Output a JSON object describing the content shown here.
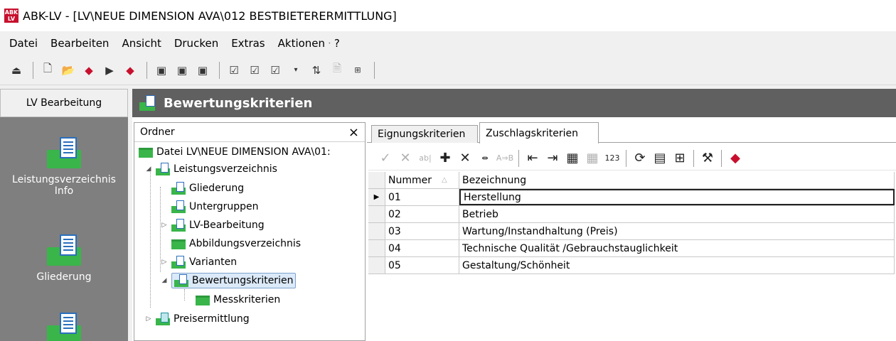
{
  "window": {
    "title": "ABK-LV - [LV\\NEUE DIMENSION AVA\\012 BESTBIETERERMITTLUNG]",
    "app_icon_text_top": "ABK",
    "app_icon_text_bottom": "LV"
  },
  "menu": [
    "Datei",
    "Bearbeiten",
    "Ansicht",
    "Drucken",
    "Extras",
    "Aktionen",
    "·",
    "?"
  ],
  "left_panel": {
    "header": "LV Bearbeitung",
    "items": [
      {
        "label_line1": "Leistungsverzeichnis",
        "label_line2": "Info"
      },
      {
        "label_line1": "Gliederung",
        "label_line2": ""
      },
      {
        "label_line1": "",
        "label_line2": ""
      }
    ]
  },
  "main_header": {
    "title": "Bewertungskriterien"
  },
  "tree": {
    "header": "Ordner",
    "close_glyph": "×",
    "nodes": {
      "root": "Datei LV\\NEUE DIMENSION AVA\\01:",
      "lv": "Leistungsverzeichnis",
      "gliederung": "Gliederung",
      "untergruppen": "Untergruppen",
      "lv_bearbeitung": "LV-Bearbeitung",
      "abbildungen": "Abbildungsverzeichnis",
      "varianten": "Varianten",
      "bewertung": "Bewertungskriterien",
      "messkriterien": "Messkriterien",
      "preisermittlung": "Preisermittlung"
    }
  },
  "tabs": {
    "eignung": "Eignungskriterien",
    "zuschlag": "Zuschlagskriterien"
  },
  "grid": {
    "col_nummer": "Nummer",
    "col_bezeichnung": "Bezeichnung",
    "rows": [
      {
        "nummer": "01",
        "bezeichnung": "Herstellung"
      },
      {
        "nummer": "02",
        "bezeichnung": "Betrieb"
      },
      {
        "nummer": "03",
        "bezeichnung": "Wartung/Instandhaltung (Preis)"
      },
      {
        "nummer": "04",
        "bezeichnung": "Technische Qualität /Gebrauchstauglichkeit"
      },
      {
        "nummer": "05",
        "bezeichnung": "Gestaltung/Schönheit"
      }
    ]
  },
  "colors": {
    "accent_green": "#39b54a",
    "accent_blue": "#2a6fbd",
    "header_gray": "#606060",
    "brand_red": "#c8102e"
  }
}
